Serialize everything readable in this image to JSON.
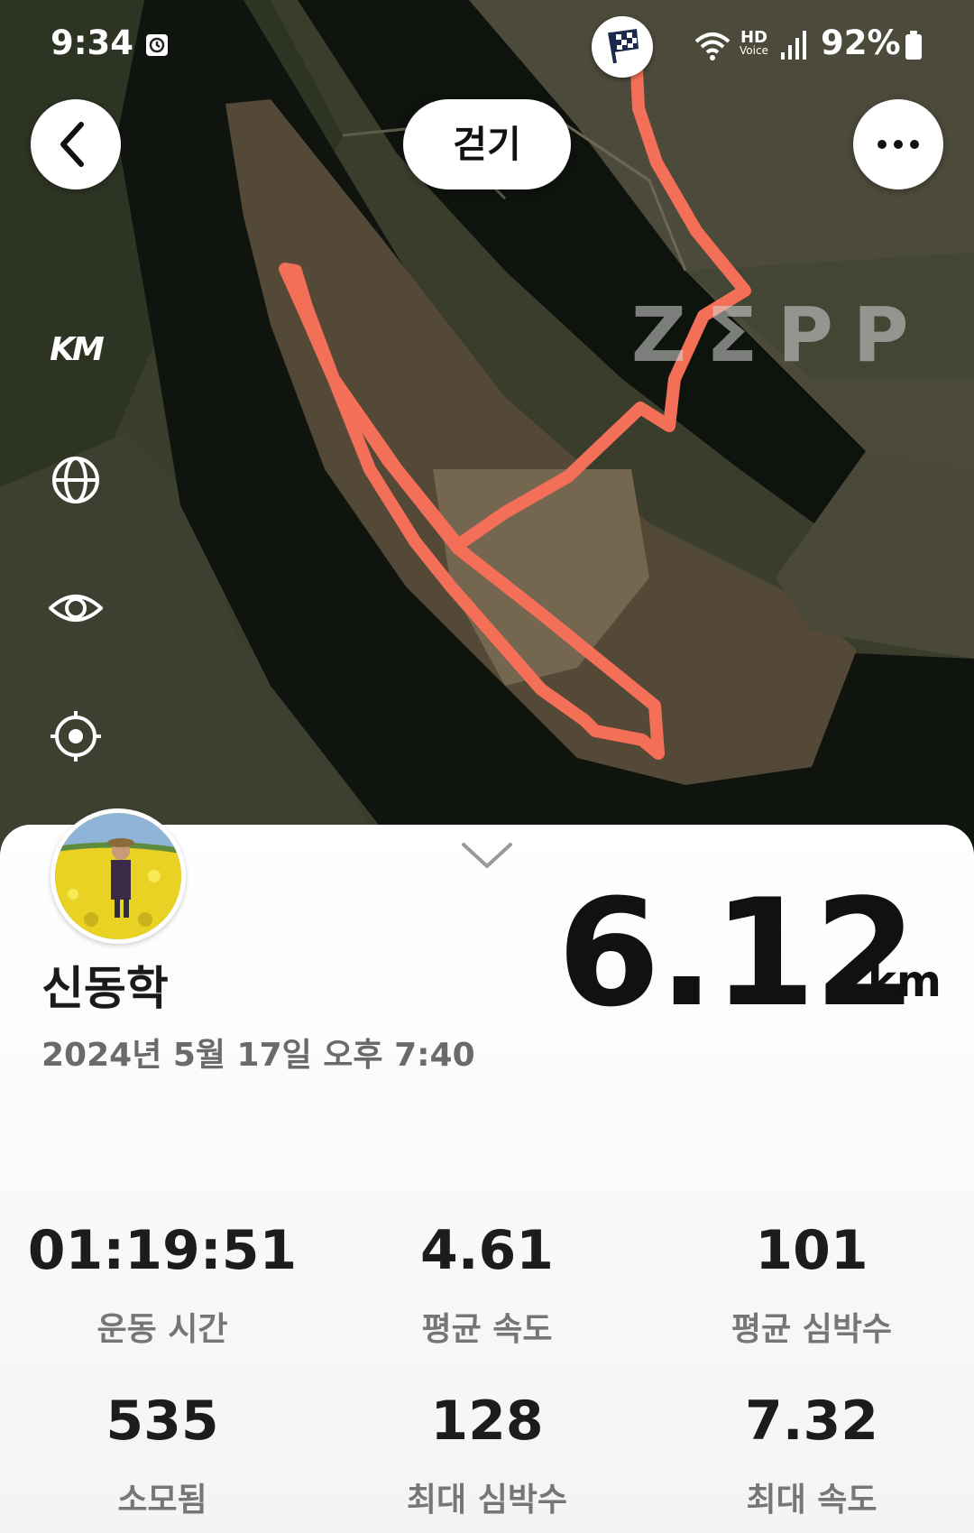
{
  "status_bar": {
    "time": "9:34",
    "battery": "92%",
    "hd_label": "HD",
    "voice_label": "Voice"
  },
  "header": {
    "title": "걷기"
  },
  "map": {
    "watermark": "ZΣPP",
    "unit_toggle_label": "KM",
    "route_color": "#f46f57",
    "tools": [
      "km-toggle-icon",
      "globe-icon",
      "eye-icon",
      "locate-icon"
    ]
  },
  "summary": {
    "user_name": "신동학",
    "datetime": "2024년 5월 17일 오후 7:40",
    "distance": "6.12",
    "distance_unit": "km"
  },
  "stats": [
    {
      "value": "01:19:51",
      "label": "운동 시간"
    },
    {
      "value": "4.61",
      "label": "평균 속도"
    },
    {
      "value": "101",
      "label": "평균 심박수"
    },
    {
      "value": "535",
      "label": "소모됨"
    },
    {
      "value": "128",
      "label": "최대 심박수"
    },
    {
      "value": "7.32",
      "label": "최대 속도"
    }
  ]
}
